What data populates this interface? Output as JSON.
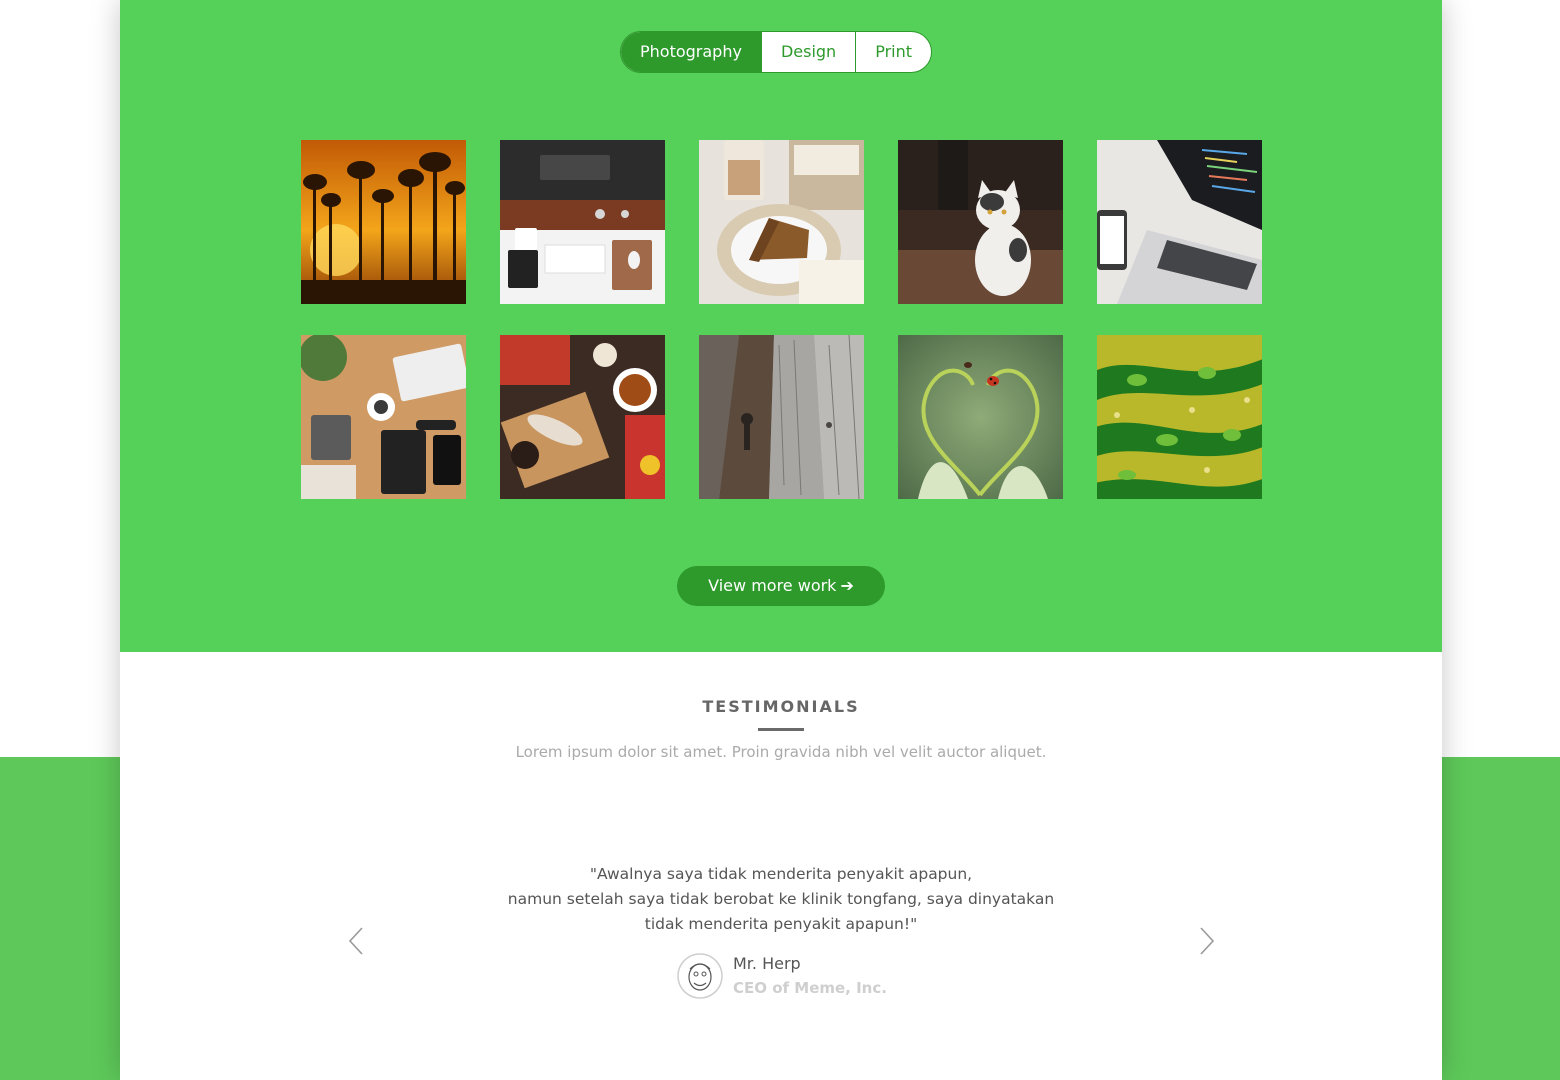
{
  "portfolio": {
    "filters": [
      {
        "label": "Photography",
        "active": true
      },
      {
        "label": "Design",
        "active": false
      },
      {
        "label": "Print",
        "active": false
      }
    ],
    "tiles": [
      {
        "icon": "sunset-forest-photo"
      },
      {
        "icon": "desk-workspace-photo"
      },
      {
        "icon": "coffee-cake-photo"
      },
      {
        "icon": "kitten-photo"
      },
      {
        "icon": "laptop-code-photo"
      },
      {
        "icon": "office-flatlay-photo"
      },
      {
        "icon": "tea-table-photo"
      },
      {
        "icon": "wood-planks-photo"
      },
      {
        "icon": "ladybug-heart-photo"
      },
      {
        "icon": "green-abstract-photo"
      }
    ],
    "cta_label": "View more work",
    "accent": "#55d15a",
    "dark_accent": "#2d9a2b"
  },
  "testimonials": {
    "title": "TESTIMONIALS",
    "subtitle": "Lorem ipsum dolor sit amet. Proin gravida nibh vel velit auctor aliquet.",
    "quote_lines": [
      "\"Awalnya saya tidak menderita penyakit apapun,",
      "namun setelah saya tidak berobat ke klinik tongfang, saya dinyatakan",
      "tidak menderita penyakit apapun!\""
    ],
    "author_name": "Mr. Herp",
    "author_role": "CEO of Meme, Inc.",
    "prev_icon": "chevron-left-icon",
    "next_icon": "chevron-right-icon"
  }
}
